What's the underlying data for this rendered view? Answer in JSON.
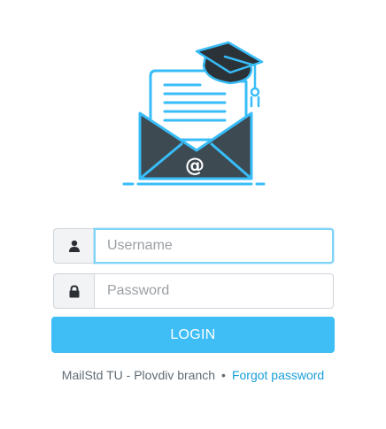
{
  "logo": {
    "icon": "envelope-graduation-cap-icon",
    "at_symbol": "@",
    "colors": {
      "outline": "#38bdf8",
      "envelope_dark": "#3d4a52",
      "cap_dark": "#2b3338",
      "paper": "#ffffff"
    }
  },
  "form": {
    "username": {
      "icon": "user-icon",
      "placeholder": "Username",
      "value": ""
    },
    "password": {
      "icon": "lock-icon",
      "placeholder": "Password",
      "value": ""
    },
    "login_button": {
      "label": "LOGIN",
      "color": "#3fbdf5"
    }
  },
  "footer": {
    "branch_text": "MailStd TU - Plovdiv branch",
    "separator": "•",
    "forgot_password_label": "Forgot password",
    "link_color": "#1a9ed9"
  }
}
